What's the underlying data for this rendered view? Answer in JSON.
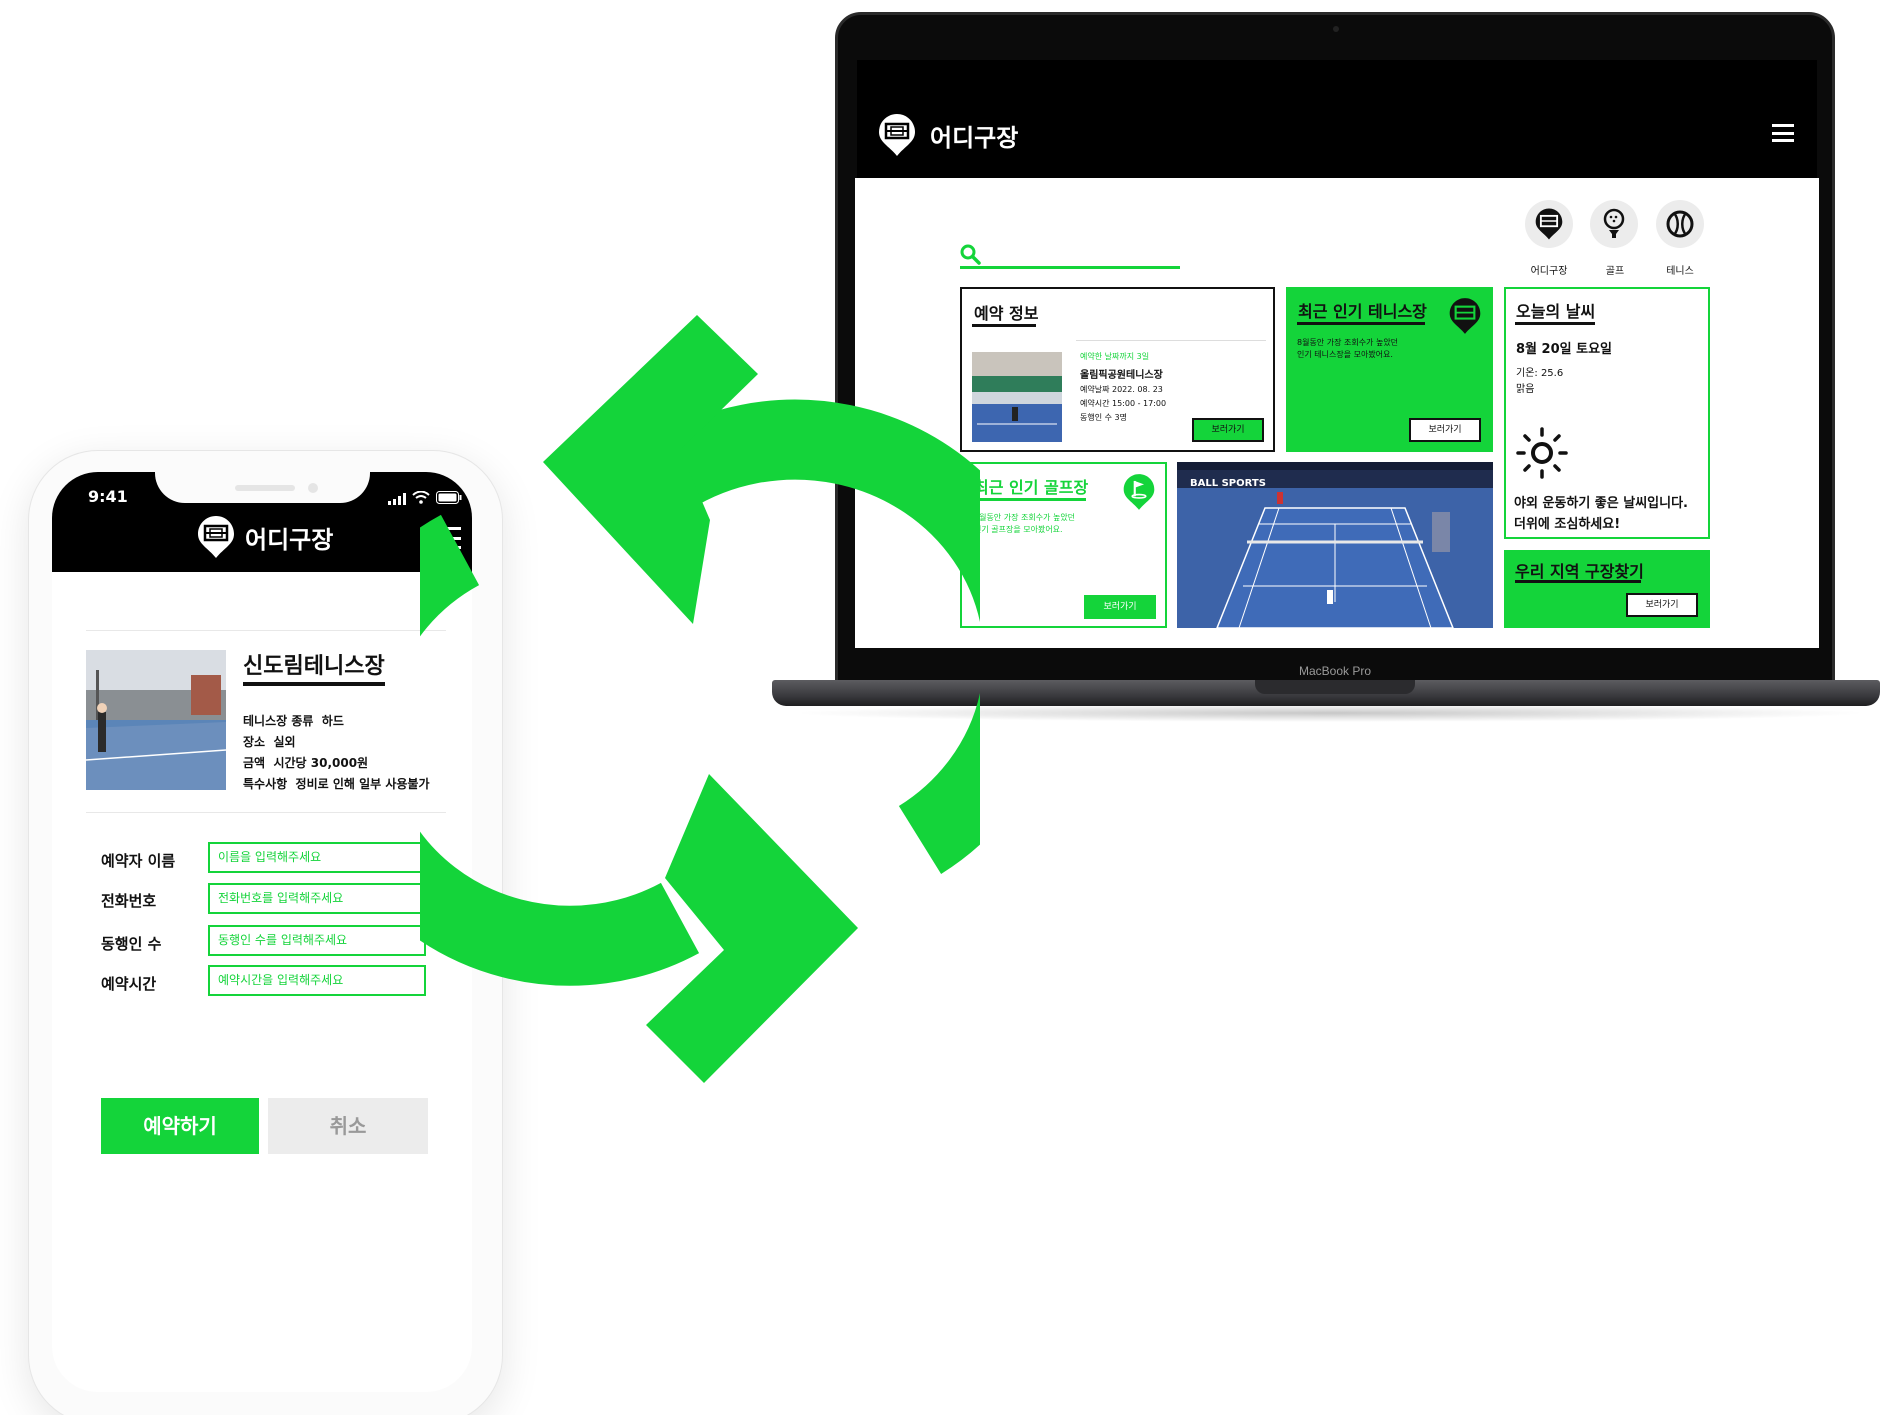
{
  "laptop": {
    "brand": "어디구장",
    "device_label": "MacBook Pro",
    "categories": [
      {
        "label": "어디구장",
        "icon": "stadium-icon"
      },
      {
        "label": "골프",
        "icon": "golf-icon"
      },
      {
        "label": "테니스",
        "icon": "tennis-ball-icon"
      }
    ],
    "reservation": {
      "title": "예약 정보",
      "days_left": "예약한 날짜까지 3일",
      "venue": "올림픽공원테니스장",
      "date": "예약날짜 2022. 08. 23",
      "time": "예약시간 15:00 - 17:00",
      "companions": "동행인 수 3명",
      "button": "보러가기"
    },
    "popular_tennis": {
      "title": "최근 인기 테니스장",
      "desc_line1": "8월동안 가장 조회수가 높았던",
      "desc_line2": "인기 테니스장을 모아봤어요.",
      "button": "보러가기"
    },
    "weather": {
      "title": "오늘의 날씨",
      "date": "8월 20일 토요일",
      "temp": "기온: 25.6",
      "condition": "맑음",
      "message_line1": "야외 운동하기 좋은 날씨입니다.",
      "message_line2": "더위에 조심하세요!"
    },
    "popular_golf": {
      "title": "최근 인기 골프장",
      "desc_line1": "8월동안 가장 조회수가 높았던",
      "desc_line2": "인기 골프장을 모아봤어요.",
      "button": "보러가기"
    },
    "video": {
      "overlay": "BALL SPORTS"
    },
    "local_search": {
      "title": "우리 지역 구장찾기",
      "button": "보러가기"
    }
  },
  "phone": {
    "time": "9:41",
    "brand": "어디구장",
    "venue": {
      "name": "신도림테니스장",
      "type_label": "테니스장 종류",
      "type_value": "하드",
      "place_label": "장소",
      "place_value": "실외",
      "price_label": "금액",
      "price_value": "시간당 30,000원",
      "note_label": "특수사항",
      "note_value": "정비로 인해 일부 사용불가"
    },
    "form": [
      {
        "label": "예약자 이름",
        "placeholder": "이름을 입력해주세요"
      },
      {
        "label": "전화번호",
        "placeholder": "전화번호를 입력해주세요"
      },
      {
        "label": "동행인 수",
        "placeholder": "동행인 수를 입력해주세요"
      },
      {
        "label": "예약시간",
        "placeholder": "예약시간을 입력해주세요"
      }
    ],
    "submit": "예약하기",
    "cancel": "취소"
  },
  "colors": {
    "accent": "#14d43a",
    "dark": "#000000",
    "muted": "#ececec"
  }
}
